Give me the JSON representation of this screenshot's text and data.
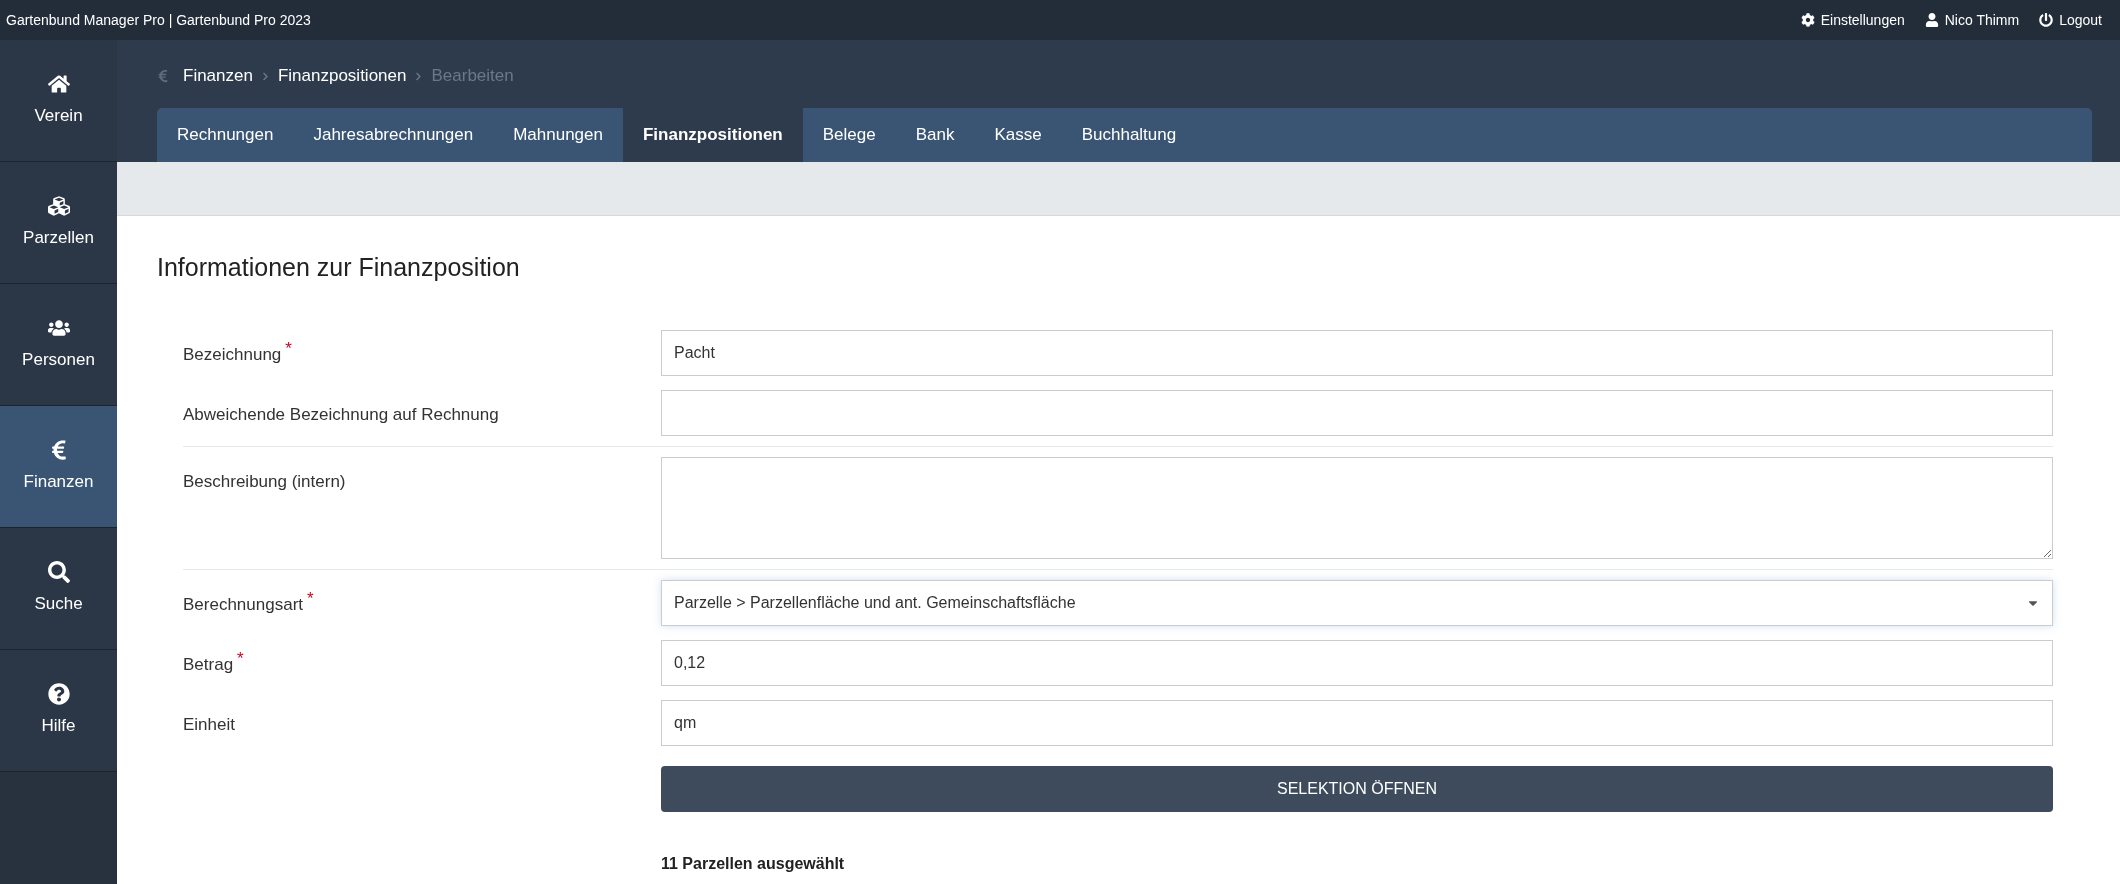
{
  "top_bar": {
    "title": "Gartenbund Manager Pro | Gartenbund Pro 2023",
    "links": [
      {
        "kind": "settings",
        "label": "Einstellungen"
      },
      {
        "kind": "user",
        "label": "Nico Thimm"
      },
      {
        "kind": "logout",
        "label": "Logout"
      }
    ]
  },
  "sidebar": {
    "items": [
      {
        "kind": "home",
        "label": "Verein",
        "selected": false
      },
      {
        "kind": "parcels",
        "label": "Parzellen",
        "selected": false
      },
      {
        "kind": "people",
        "label": "Personen",
        "selected": false
      },
      {
        "kind": "euro",
        "label": "Finanzen",
        "selected": true
      },
      {
        "kind": "search",
        "label": "Suche",
        "selected": false
      },
      {
        "kind": "help",
        "label": "Hilfe",
        "selected": false
      }
    ]
  },
  "breadcrumbs": [
    {
      "label": "Finanzen",
      "current": false
    },
    {
      "label": "Finanzpositionen",
      "current": false
    },
    {
      "label": "Bearbeiten",
      "current": true
    }
  ],
  "tabs": [
    {
      "label": "Rechnungen",
      "selected": false
    },
    {
      "label": "Jahresabrechnungen",
      "selected": false
    },
    {
      "label": "Mahnungen",
      "selected": false
    },
    {
      "label": "Finanzpositionen",
      "selected": true
    },
    {
      "label": "Belege",
      "selected": false
    },
    {
      "label": "Bank",
      "selected": false
    },
    {
      "label": "Kasse",
      "selected": false
    },
    {
      "label": "Buchhaltung",
      "selected": false
    }
  ],
  "form": {
    "title": "Informationen zur Finanzposition",
    "fields": [
      {
        "kind": "text",
        "label": "Bezeichnung",
        "required_mark": "*",
        "value": "Pacht"
      },
      {
        "kind": "text",
        "label": "Abweichende Bezeichnung auf Rechnung"
      },
      {
        "kind": "divider"
      },
      {
        "kind": "textarea",
        "label": "Beschreibung (intern)"
      },
      {
        "kind": "divider"
      },
      {
        "kind": "select",
        "label": "Berechnungsart",
        "required_mark": "*",
        "value": "Parzelle > Parzellenfläche und ant. Gemeinschaftsfläche"
      },
      {
        "kind": "text",
        "label": "Betrag",
        "required_mark": "*",
        "value": "0,12"
      },
      {
        "kind": "text",
        "label": "Einheit",
        "value": "qm"
      }
    ],
    "selection_button": "SELEKTION ÖFFNEN",
    "selection_summary": "11 Parzellen ausgewählt"
  }
}
